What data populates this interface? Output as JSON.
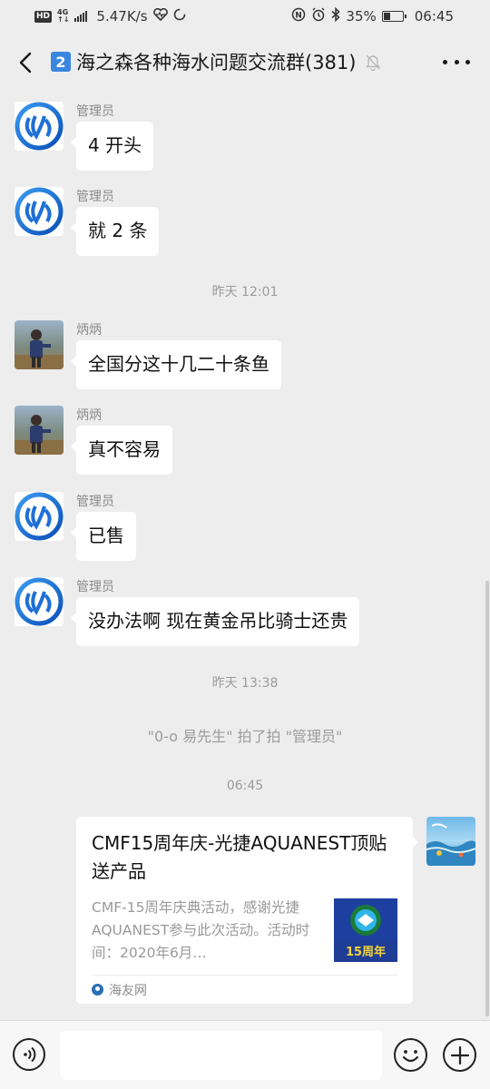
{
  "status_bar": {
    "hd": "HD",
    "network_top": "4G",
    "network_bottom": "↑↓",
    "speed": "5.47K/s",
    "battery_percent": "35%",
    "battery_level": 0.35,
    "time": "06:45"
  },
  "header": {
    "group_number": "2",
    "title": "海之森各种海水问题交流群(381)"
  },
  "messages": [
    {
      "sender": "管理员",
      "text": "4 开头"
    },
    {
      "sender": "管理员",
      "text": "就 2 条"
    },
    {
      "sender": "炳炳",
      "text": "全国分这十几二十条鱼"
    },
    {
      "sender": "炳炳",
      "text": "真不容易"
    },
    {
      "sender": "管理员",
      "text": "已售"
    },
    {
      "sender": "管理员",
      "text": "没办法啊  现在黄金吊比骑士还贵"
    }
  ],
  "timestamps": [
    "昨天 12:01",
    "昨天 13:38",
    "06:45"
  ],
  "system_notice": "\"0-o 易先生\" 拍了拍 \"管理员\"",
  "link_card": {
    "title": "CMF15周年庆-光捷AQUANEST顶贴送产品",
    "description": "CMF-15周年庆典活动，感谢光捷AQUANEST参与此次活动。活动时间：2020年6月…",
    "thumbnail_text": "15周年",
    "source": "海友网"
  },
  "colors": {
    "background": "#ededed",
    "bubble": "#ffffff",
    "number_badge": "#3a86e0",
    "admin_avatar": "#1f6fd6"
  }
}
